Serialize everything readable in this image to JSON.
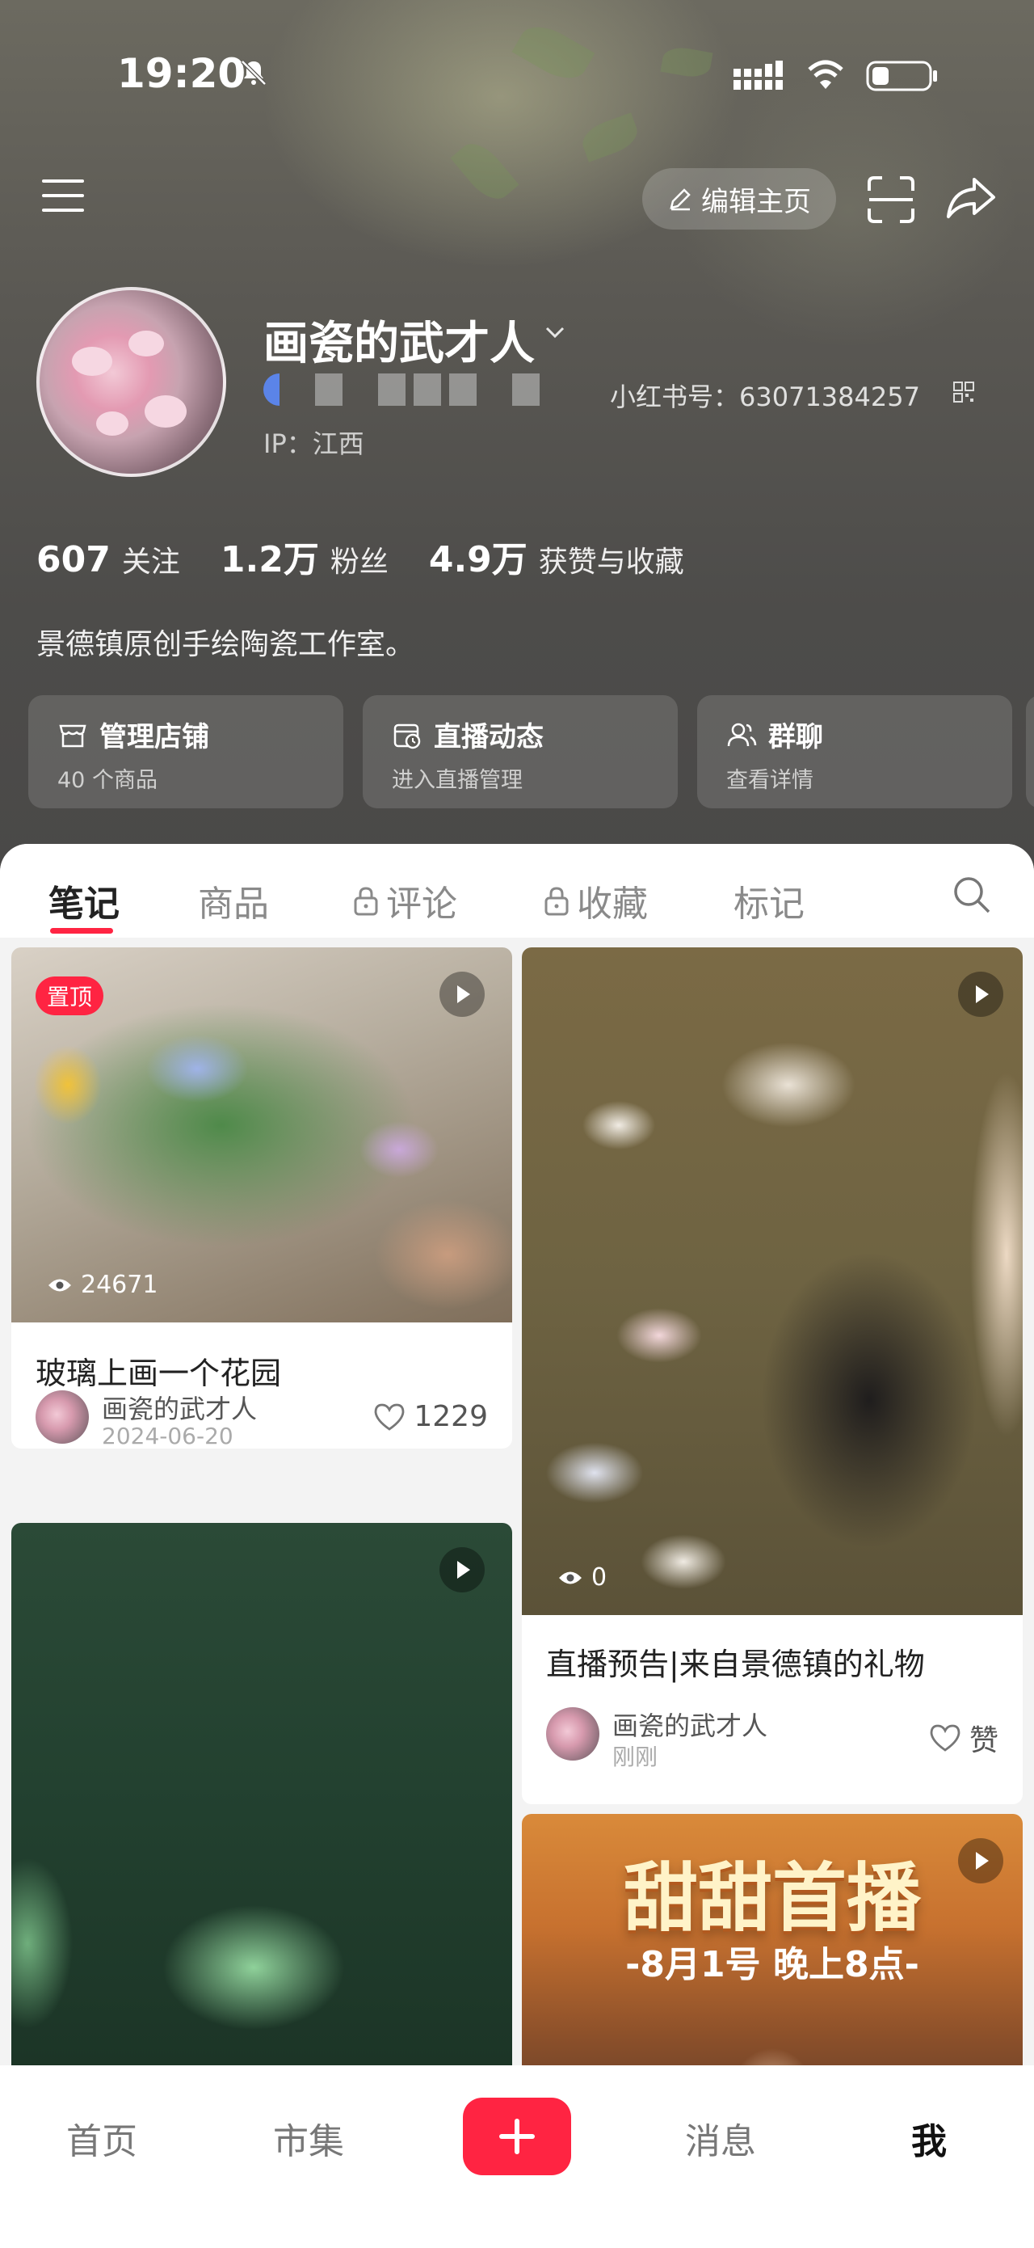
{
  "status_bar": {
    "time": "19:20"
  },
  "header": {
    "edit_label": "编辑主页"
  },
  "profile": {
    "name": "画瓷的武才人",
    "red_id": "小红书号：63071384257",
    "ip": "IP：江西",
    "bio": "景德镇原创手绘陶瓷工作室。",
    "stats": [
      {
        "value": "607",
        "label": "关注"
      },
      {
        "value": "1.2万",
        "label": "粉丝"
      },
      {
        "value": "4.9万",
        "label": "获赞与收藏"
      }
    ]
  },
  "cards": [
    {
      "title": "管理店铺",
      "subtitle": "40 个商品",
      "icon": "store-icon"
    },
    {
      "title": "直播动态",
      "subtitle": "进入直播管理",
      "icon": "live-calendar-icon"
    },
    {
      "title": "群聊",
      "subtitle": "查看详情",
      "icon": "group-icon"
    }
  ],
  "tabs": [
    {
      "label": "笔记",
      "active": true
    },
    {
      "label": "商品"
    },
    {
      "label": "评论",
      "locked": true
    },
    {
      "label": "收藏",
      "locked": true
    },
    {
      "label": "标记"
    }
  ],
  "notes": [
    {
      "pin": "置顶",
      "views": "24671",
      "title": "玻璃上画一个花园",
      "author": "画瓷的武才人",
      "date": "2024-06-20",
      "likes": "1229"
    },
    {
      "views": "0",
      "title": "直播预告|来自景德镇的礼物",
      "author": "画瓷的武才人",
      "date": "刚刚",
      "likes": "赞"
    },
    {
      "title": ""
    },
    {
      "banner_title": "甜甜首播",
      "banner_sub": "-8月1号 晚上8点-"
    }
  ],
  "bottom_nav": [
    {
      "label": "首页"
    },
    {
      "label": "市集"
    },
    {
      "label": "消息"
    },
    {
      "label": "我",
      "active": true
    }
  ],
  "colors": {
    "brand": "#ff2442",
    "header_bg": "#5a5853"
  }
}
